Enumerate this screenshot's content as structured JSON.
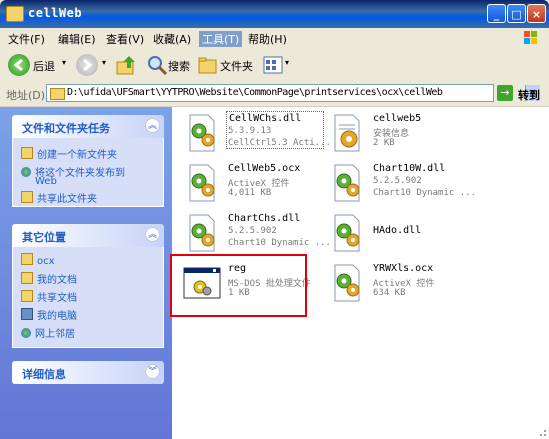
{
  "window": {
    "title": "cellWeb"
  },
  "menu": {
    "items": [
      "文件(F)",
      "编辑(E)",
      "查看(V)",
      "收藏(A)",
      "工具(T)",
      "帮助(H)"
    ],
    "selected": "工具(T)"
  },
  "toolbar": {
    "back": "后退",
    "search": "搜索",
    "folders": "文件夹"
  },
  "address": {
    "label": "地址(D)",
    "path": "D:\\ufida\\UFSmart\\YYTPRO\\Website\\CommonPage\\printservices\\ocx\\cellWeb",
    "go": "转到"
  },
  "tasks": {
    "title": "文件和文件夹任务",
    "items": [
      "创建一个新文件夹",
      "将这个文件夹发布到",
      "Web",
      "共享此文件夹"
    ]
  },
  "places": {
    "title": "其它位置",
    "items": [
      "ocx",
      "我的文档",
      "共享文档",
      "我的电脑",
      "网上邻居"
    ]
  },
  "details": {
    "title": "详细信息"
  },
  "files": [
    {
      "name": "CellWChs.dll",
      "line2": "5.3.9.13",
      "line3": "CellCtrl5.3 Acti...",
      "icon": "dll-gear-icon"
    },
    {
      "name": "cellweb5",
      "line2": "安装信息",
      "line3": "2 KB",
      "icon": "inf-settings-icon"
    },
    {
      "name": "CellWeb5.ocx",
      "line2": "ActiveX 控件",
      "line3": "4,011 KB",
      "icon": "ocx-gear-icon"
    },
    {
      "name": "Chart10W.dll",
      "line2": "5.2.5.902",
      "line3": "Chart10 Dynamic ...",
      "icon": "dll-gear-icon"
    },
    {
      "name": "ChartChs.dll",
      "line2": "5.2.5.902",
      "line3": "Chart10 Dynamic ...",
      "icon": "dll-gear-icon"
    },
    {
      "name": "HAdo.dll",
      "line2": "",
      "line3": "",
      "icon": "dll-gear-icon"
    },
    {
      "name": "reg",
      "line2": "MS-DOS 批处理文件",
      "line3": "1 KB",
      "icon": "batch-file-icon"
    },
    {
      "name": "YRWXls.ocx",
      "line2": "ActiveX 控件",
      "line3": "634 KB",
      "icon": "ocx-gear-icon"
    }
  ]
}
